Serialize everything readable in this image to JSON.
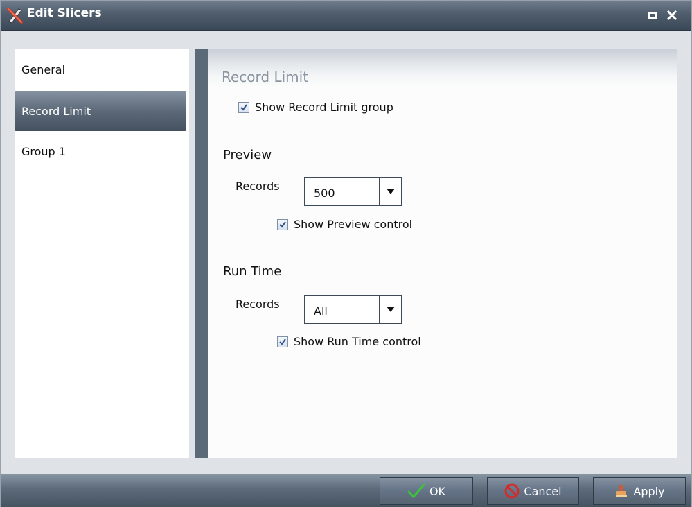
{
  "window": {
    "title": "Edit Slicers"
  },
  "nav": {
    "items": [
      {
        "label": "General",
        "selected": false
      },
      {
        "label": "Record Limit",
        "selected": true
      },
      {
        "label": "Group 1",
        "selected": false
      }
    ]
  },
  "content": {
    "section_title": "Record Limit",
    "show_group": {
      "label": "Show Record Limit group",
      "checked": true
    },
    "preview": {
      "heading": "Preview",
      "records_label": "Records",
      "records_value": "500",
      "show_control": {
        "label": "Show Preview control",
        "checked": true
      }
    },
    "runtime": {
      "heading": "Run Time",
      "records_label": "Records",
      "records_value": "All",
      "show_control": {
        "label": "Show Run Time control",
        "checked": true
      }
    }
  },
  "footer": {
    "ok_label": "OK",
    "cancel_label": "Cancel",
    "apply_label": "Apply"
  },
  "colors": {
    "titlebar": "#4f5d6d",
    "selected_nav": "#5c6979",
    "splitter": "#5b6a77",
    "ok_check": "#3ec23e",
    "cancel_icon": "#d42a2a"
  },
  "icons": {
    "title": "edit-slicers-icon",
    "maximize": "maximize-icon",
    "close": "close-icon",
    "ok": "checkmark-icon",
    "cancel": "cancel-icon",
    "apply": "apply-stamp-icon"
  }
}
